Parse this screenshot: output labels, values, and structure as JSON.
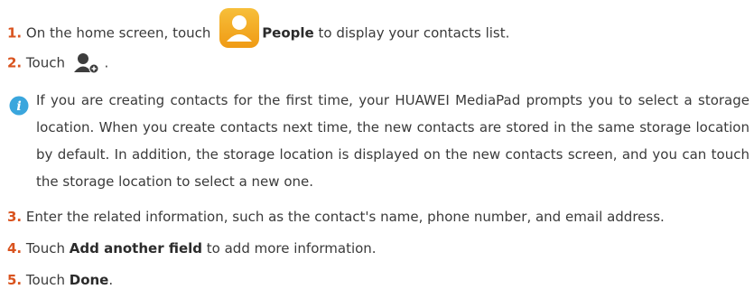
{
  "steps": [
    {
      "num": "1.",
      "pre": "On the home screen, touch",
      "bold": "People",
      "post": "to display your contacts list."
    },
    {
      "num": "2.",
      "pre": "Touch",
      "post": "."
    },
    {
      "num": "3.",
      "pre": "Enter the related information, such as the contact's name, phone number, and email address."
    },
    {
      "num": "4.",
      "pre": "Touch",
      "bold": "Add another field",
      "post": "to add more information."
    },
    {
      "num": "5.",
      "pre": "Touch",
      "bold": "Done",
      "post": "."
    }
  ],
  "note": {
    "icon": "info-icon",
    "text": "If you are creating contacts for the first time, your HUAWEI MediaPad prompts you to select a storage location. When you create contacts next time, the new contacts are stored in the same storage location by default. In addition, the storage location is displayed on the new contacts screen, and you can touch the storage location to select a new one."
  },
  "icons": {
    "people": "people-app-icon",
    "add_contact": "add-contact-icon"
  },
  "colors": {
    "step_number": "#d9531e",
    "people_icon": "#f2a51f",
    "info_icon": "#3aa6dd"
  }
}
